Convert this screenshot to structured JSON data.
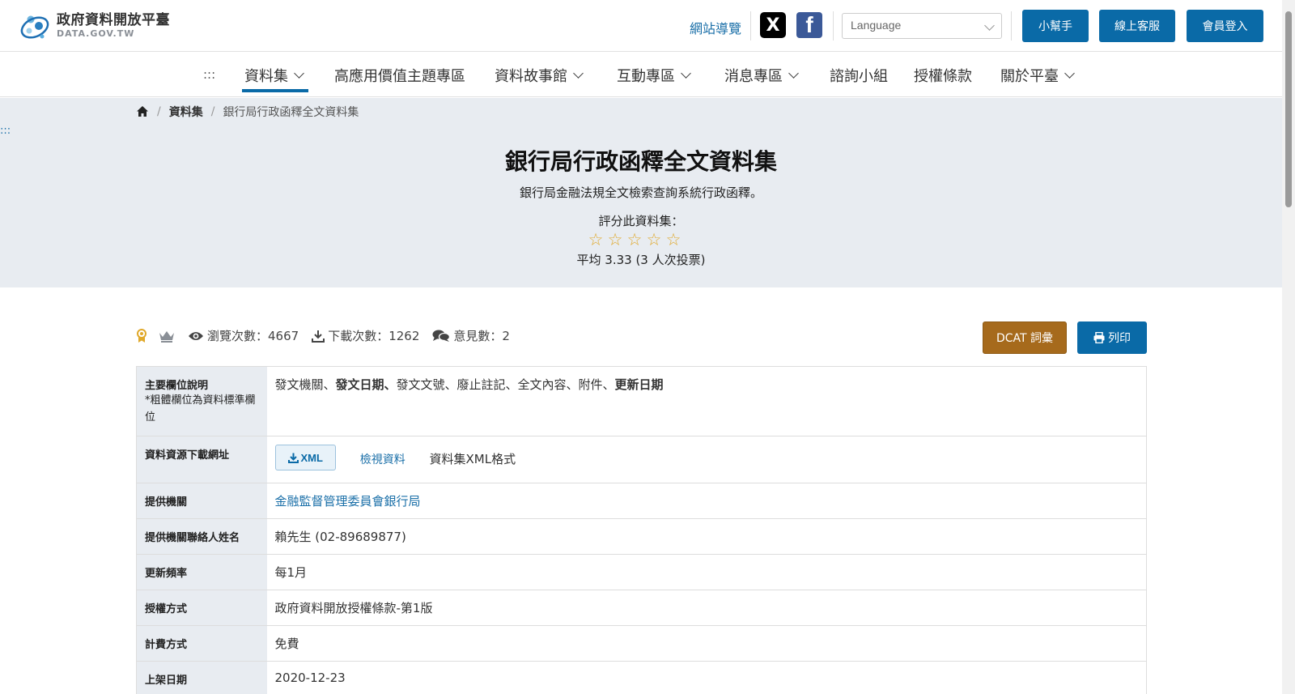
{
  "header": {
    "logo_title": "政府資料開放平臺",
    "logo_sub": "DATA.GOV.TW",
    "sitemap": "網站導覽",
    "social_x": "X",
    "social_fb": "f",
    "language_placeholder": "Language",
    "buttons": [
      "小幫手",
      "線上客服",
      "會員登入"
    ]
  },
  "nav": {
    "menu_glyph": ":::",
    "items": [
      "資料集",
      "高應用價值主題專區",
      "資料故事館",
      "互動專區",
      "消息專區",
      "諮詢小組",
      "授權條款",
      "關於平臺"
    ]
  },
  "breadcrumb": {
    "section": "資料集",
    "current": "銀行局行政函釋全文資料集"
  },
  "skip_glyph": ":::",
  "hero": {
    "title": "銀行局行政函釋全文資料集",
    "description": "銀行局金融法規全文檢索查詢系統行政函釋。",
    "rate_label": "評分此資料集：",
    "star_glyph": "☆",
    "average_text": "平均 3.33 (3 人次投票)"
  },
  "stats": {
    "views_label": "瀏覽次數：",
    "views": "4667",
    "downloads_label": "下載次數：",
    "downloads": "1262",
    "comments_label": "意見數：",
    "comments": "2"
  },
  "actions": {
    "dcat": "DCAT 詞彙",
    "print": "列印"
  },
  "table": {
    "fields": {
      "label": "主要欄位說明",
      "note": "*粗體欄位為資料標準欄位",
      "parts": [
        {
          "text": "發文機關、",
          "bold": false
        },
        {
          "text": "發文日期、",
          "bold": true
        },
        {
          "text": "發文文號、廢止註記、全文內容、附件、",
          "bold": false
        },
        {
          "text": "更新日期",
          "bold": true
        }
      ]
    },
    "download": {
      "label": "資料資源下載網址",
      "format_button": "XML",
      "view_link": "檢視資料",
      "format_desc": "資料集XML格式"
    },
    "provider": {
      "label": "提供機關",
      "value": "金融監督管理委員會銀行局"
    },
    "contact": {
      "label": "提供機關聯絡人姓名",
      "value": "賴先生 (02-89689877)"
    },
    "frequency": {
      "label": "更新頻率",
      "value": "每1月"
    },
    "license": {
      "label": "授權方式",
      "value": "政府資料開放授權條款-第1版"
    },
    "fee": {
      "label": "計費方式",
      "value": "免費"
    },
    "published": {
      "label": "上架日期",
      "value": "2020-12-23"
    }
  }
}
